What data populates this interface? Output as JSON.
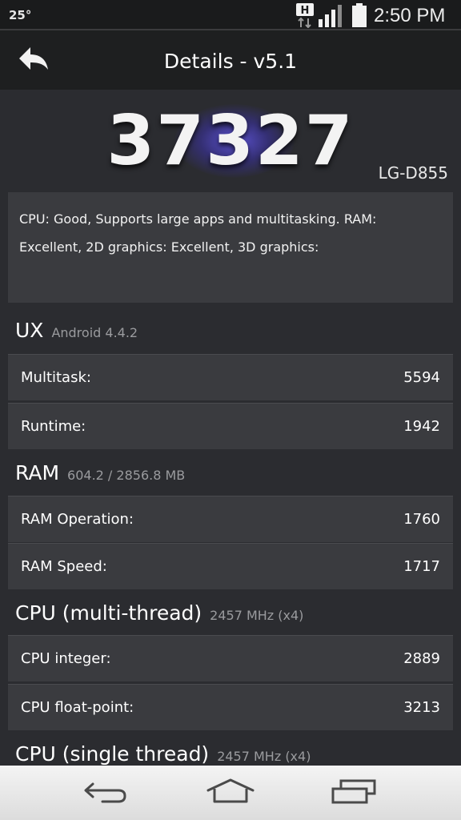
{
  "status_bar": {
    "temperature": "25°",
    "network_badge": "H",
    "time": "2:50 PM",
    "icons": [
      "hspa-data-icon",
      "signal-icon",
      "battery-icon"
    ]
  },
  "action_bar": {
    "title": "Details - v5.1",
    "back_icon": "back-arrow-icon"
  },
  "score": {
    "value": "37327",
    "device": "LG-D855"
  },
  "summary": {
    "text": "CPU: Good, Supports large apps and multitasking. RAM: Excellent, 2D graphics: Excellent, 3D graphics:"
  },
  "sections": [
    {
      "title": "UX",
      "subtitle": "Android 4.4.2",
      "rows": [
        {
          "label": "Multitask:",
          "value": "5594"
        },
        {
          "label": "Runtime:",
          "value": "1942"
        }
      ]
    },
    {
      "title": "RAM",
      "subtitle": "604.2 / 2856.8 MB",
      "rows": [
        {
          "label": "RAM Operation:",
          "value": "1760"
        },
        {
          "label": "RAM Speed:",
          "value": "1717"
        }
      ]
    },
    {
      "title": "CPU (multi-thread)",
      "subtitle": "2457 MHz (x4)",
      "rows": [
        {
          "label": "CPU integer:",
          "value": "2889"
        },
        {
          "label": "CPU float-point:",
          "value": "3213"
        }
      ]
    },
    {
      "title": "CPU (single thread)",
      "subtitle": "2457 MHz (x4)",
      "rows": []
    }
  ],
  "nav_bar": {
    "icons": [
      "back-icon",
      "home-icon",
      "recent-apps-icon"
    ]
  },
  "colors": {
    "background": "#2b2c30",
    "card": "#3a3b3f",
    "action_bar": "#1e1f20",
    "score_glow": "#5f55dc"
  }
}
